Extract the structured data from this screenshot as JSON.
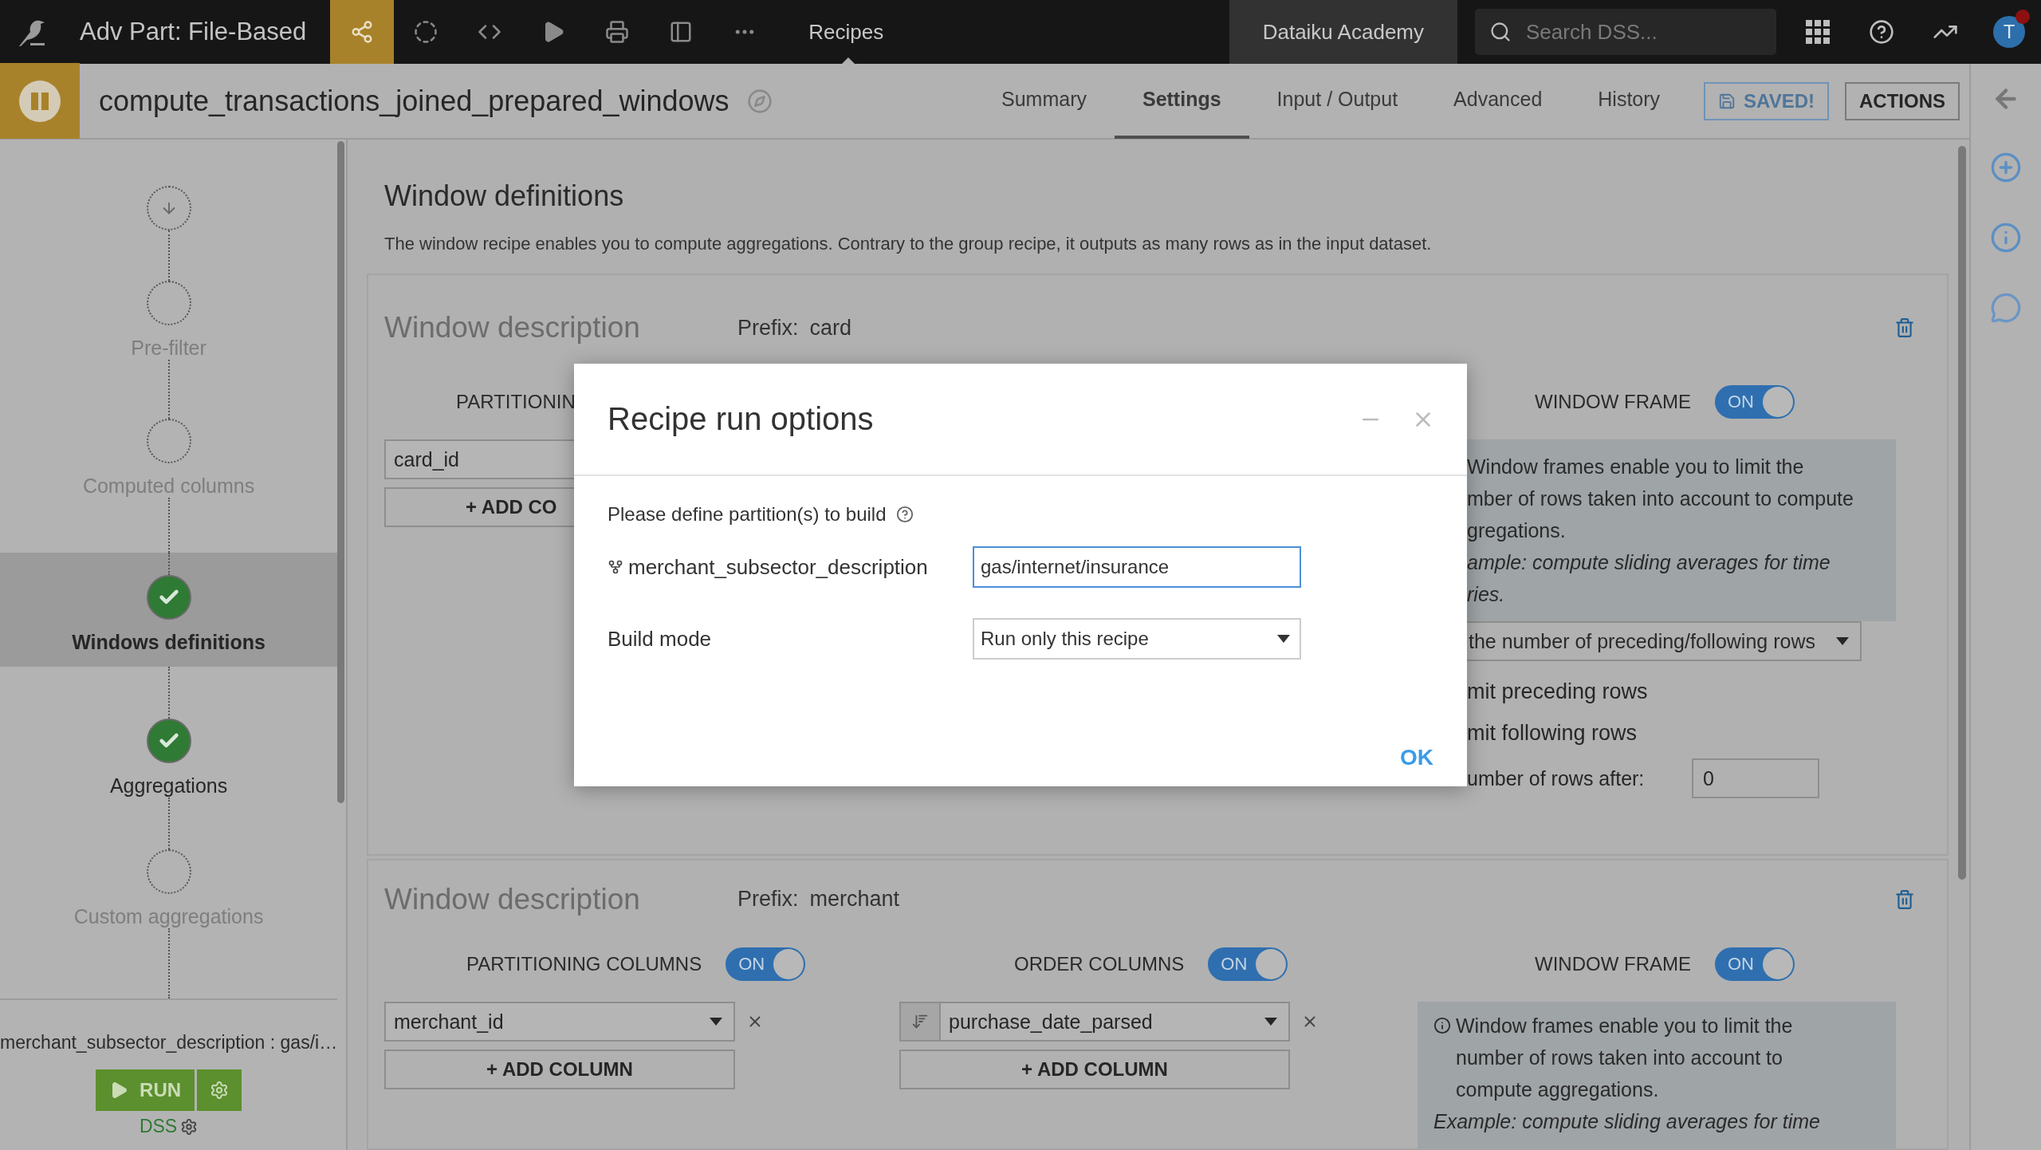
{
  "topbar": {
    "project": "Adv Part: File-Based",
    "section": "Recipes",
    "instance": "Dataiku Academy",
    "search": {
      "placeholder": "Search DSS..."
    },
    "avatar": "T"
  },
  "header": {
    "title": "compute_transactions_joined_prepared_windows",
    "tabs": [
      {
        "label": "Summary",
        "selected": false
      },
      {
        "label": "Settings",
        "selected": true
      },
      {
        "label": "Input / Output",
        "selected": false
      },
      {
        "label": "Advanced",
        "selected": false
      },
      {
        "label": "History",
        "selected": false
      }
    ],
    "buttons": [
      {
        "label": "SAVED!",
        "kind": "saved"
      },
      {
        "label": "ACTIONS",
        "kind": "actions"
      }
    ]
  },
  "sidebar": {
    "steps": [
      {
        "kind": "start",
        "done": false,
        "selected": false
      },
      {
        "kind": "step",
        "label": "Pre-filter",
        "done": false,
        "selected": false
      },
      {
        "kind": "step",
        "label": "Computed columns",
        "done": false,
        "selected": false
      },
      {
        "kind": "step",
        "label": "Windows definitions",
        "done": true,
        "selected": true
      },
      {
        "kind": "step",
        "label": "Aggregations",
        "done": true,
        "selected": false
      },
      {
        "kind": "step",
        "label": "Custom aggregations",
        "done": false,
        "selected": false
      }
    ],
    "partition": "merchant_subsector_description : gas/i…",
    "run": "RUN",
    "engine": "DSS"
  },
  "page": {
    "title": "Window definitions",
    "description": "The window recipe enables you to compute aggregations. Contrary to the group recipe, it outputs as many rows as in the input dataset.",
    "cards": [
      {
        "kind": "covered",
        "title": "Window description",
        "prefix_label": "Prefix:",
        "prefix": "card",
        "partitioning": {
          "label": "PARTITIONIN",
          "columns": [
            "card_id"
          ],
          "add": "+ ADD CO"
        },
        "frame": {
          "label": "WINDOW FRAME",
          "on": true,
          "toggle": "ON",
          "info_lines": [
            "Window frames enable you to limit the",
            "mber of rows taken into account to compute",
            "gregations."
          ],
          "example_lines": [
            "ample: compute sliding averages for time",
            "ries."
          ],
          "mode": "the number of preceding/following rows",
          "rows": [
            "mit preceding rows",
            "mit following rows"
          ],
          "after_label": "umber of rows after:",
          "after": "0"
        }
      },
      {
        "kind": "full",
        "title": "Window description",
        "prefix_label": "Prefix:",
        "prefix": "merchant",
        "partitioning": {
          "label": "PARTITIONING COLUMNS",
          "on": true,
          "toggle": "ON",
          "columns": [
            "merchant_id"
          ],
          "add": "+ ADD COLUMN"
        },
        "order": {
          "label": "ORDER COLUMNS",
          "on": true,
          "toggle": "ON",
          "columns": [
            "purchase_date_parsed"
          ],
          "add": "+ ADD COLUMN"
        },
        "frame": {
          "label": "WINDOW FRAME",
          "on": true,
          "toggle": "ON",
          "info": "Window frames enable you to limit the number of rows taken into account to compute aggregations.",
          "example": "Example: compute sliding averages for time"
        }
      }
    ]
  },
  "modal": {
    "title": "Recipe run options",
    "intro": "Please define partition(s) to build",
    "partition": {
      "label": "merchant_subsector_description",
      "value": "gas/internet/insurance"
    },
    "build": {
      "label": "Build mode",
      "value": "Run only this recipe"
    },
    "ok": "OK"
  }
}
